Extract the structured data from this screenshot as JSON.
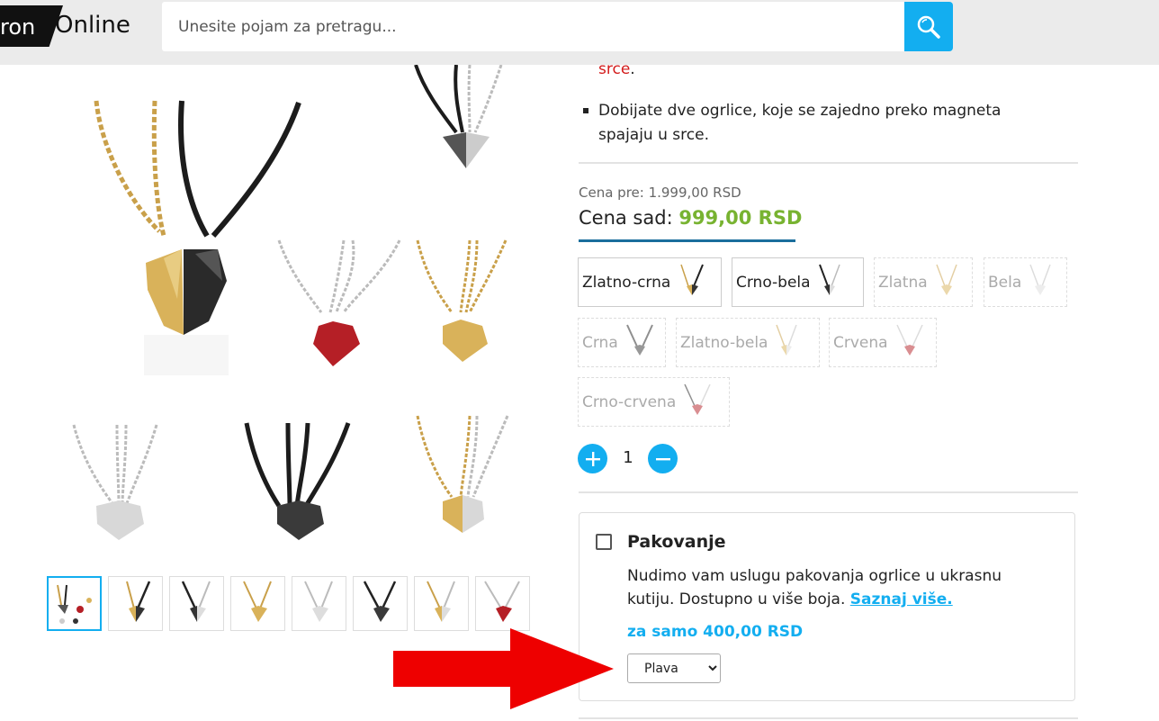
{
  "header": {
    "logo_left": "ron",
    "logo_right": "Online",
    "search": {
      "placeholder": "Unesite pojam za pretragu...",
      "value": ""
    }
  },
  "gallery": {
    "thumbnails": [
      "thumb-1",
      "thumb-2",
      "thumb-3",
      "thumb-4",
      "thumb-5",
      "thumb-6",
      "thumb-7",
      "thumb-8"
    ],
    "active_index": 0
  },
  "description": {
    "trailing_red": "srce",
    "trailing_dot": ".",
    "bullet": "Dobijate dve ogrlice, koje se zajedno preko magneta spajaju u srce."
  },
  "price": {
    "old_label": "Cena pre: 1.999,00 RSD",
    "new_label": "Cena sad: ",
    "new_value": "999,00 RSD"
  },
  "variants": [
    {
      "label": "Zlatno-crna",
      "available": true
    },
    {
      "label": "Crno-bela",
      "available": true
    },
    {
      "label": "Zlatna",
      "available": false
    },
    {
      "label": "Bela",
      "available": false
    },
    {
      "label": "Crna",
      "available": false
    },
    {
      "label": "Zlatno-bela",
      "available": false
    },
    {
      "label": "Crvena",
      "available": false
    },
    {
      "label": "Crno-crvena",
      "available": false
    }
  ],
  "quantity": {
    "value": "1"
  },
  "packaging": {
    "title": "Pakovanje",
    "text": "Nudimo vam uslugu pakovanja ogrlice u ukrasnu kutiju. Dostupno u više boja. ",
    "link": "Saznaj više.",
    "price": "za samo 400,00 RSD",
    "select_value": "Plava",
    "checked": false
  },
  "colors": {
    "accent": "#13aef0",
    "price_green": "#78b331",
    "red_text": "#d31b1b",
    "arrow": "#ee0000"
  }
}
